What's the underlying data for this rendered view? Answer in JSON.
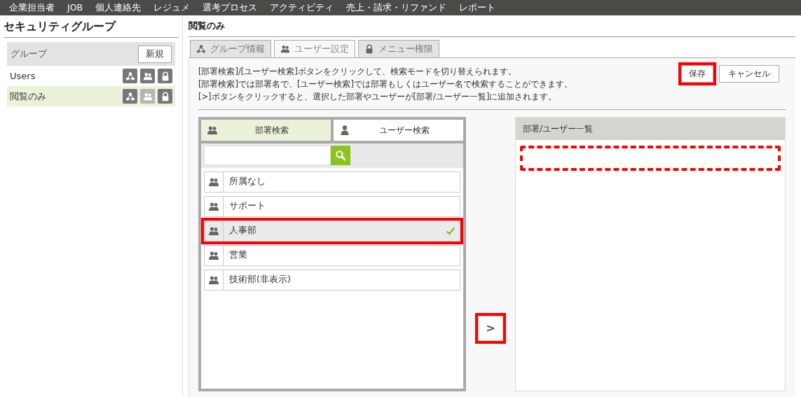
{
  "nav": [
    "企業担当者",
    "JOB",
    "個人連絡先",
    "レジュメ",
    "選考プロセス",
    "アクティビティ",
    "売上・請求・リファンド",
    "レポート"
  ],
  "sidebar": {
    "title": "セキュリティグループ",
    "header": "グループ",
    "new_button": "新規",
    "groups": [
      {
        "name": "Users",
        "selected": false,
        "icons": [
          {
            "kind": "org",
            "current": false
          },
          {
            "kind": "users",
            "current": false
          },
          {
            "kind": "lock",
            "current": false
          }
        ]
      },
      {
        "name": "閲覧のみ",
        "selected": true,
        "icons": [
          {
            "kind": "org",
            "current": false
          },
          {
            "kind": "users",
            "current": true
          },
          {
            "kind": "lock",
            "current": false
          }
        ]
      }
    ]
  },
  "main": {
    "title": "閲覧のみ",
    "tabs": [
      {
        "label": "グループ情報",
        "kind": "org",
        "selected": false
      },
      {
        "label": "ユーザー設定",
        "kind": "users",
        "selected": true
      },
      {
        "label": "メニュー権限",
        "kind": "lock",
        "selected": false
      }
    ],
    "help": [
      "[部署検索]/[ユーザー検索]ボタンをクリックして、検索モードを切り替えられます。",
      "[部署検索]では部署名で、[ユーザー検索]では部署もしくはユーザー名で検索することができます。",
      "[>]ボタンをクリックすると、選択した部署やユーザーが[部署/ユーザー一覧]に追加されます。"
    ],
    "save_button": {
      "label": "保存",
      "highlighted": true
    },
    "cancel_button": {
      "label": "キャンセル",
      "highlighted": false
    },
    "search_modes": [
      {
        "label": "部署検索",
        "kind": "users",
        "selected": true
      },
      {
        "label": "ユーザー検索",
        "kind": "user",
        "selected": false
      }
    ],
    "departments": [
      {
        "name": "所属なし",
        "selected": false,
        "highlighted": false
      },
      {
        "name": "サポート",
        "selected": false,
        "highlighted": false
      },
      {
        "name": "人事部",
        "selected": true,
        "highlighted": true
      },
      {
        "name": "営業",
        "selected": false,
        "highlighted": false
      },
      {
        "name": "技術部(非表示)",
        "selected": false,
        "highlighted": false
      }
    ],
    "add_button": {
      "label": ">",
      "highlighted": true
    },
    "list": {
      "title": "部署/ユーザー一覧",
      "drop_highlighted": true
    }
  }
}
